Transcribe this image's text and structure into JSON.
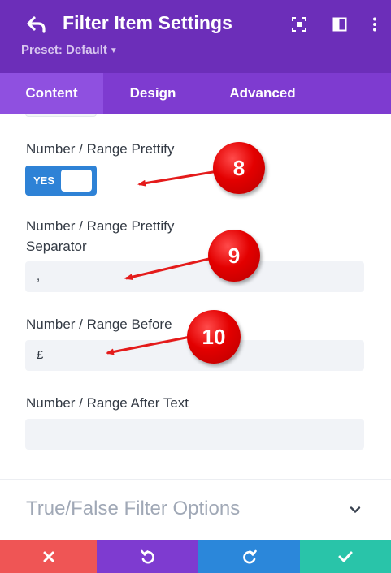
{
  "header": {
    "title": "Filter Item Settings",
    "preset_label": "Preset: Default",
    "icons": [
      "back-icon",
      "focus-icon",
      "sidebar-layout-icon",
      "more-icon"
    ],
    "bg_color": "#6c2eb9"
  },
  "tabs": [
    {
      "label": "Content",
      "active": true
    },
    {
      "label": "Design",
      "active": false
    },
    {
      "label": "Advanced",
      "active": false
    }
  ],
  "fields": {
    "prettify": {
      "label": "Number / Range Prettify",
      "toggle_text": "YES",
      "value": true
    },
    "separator": {
      "label_line1": "Number / Range Prettify",
      "label_line2": "Separator",
      "value": ","
    },
    "before_text": {
      "label": "Number / Range Before",
      "value": "£"
    },
    "after_text": {
      "label": "Number / Range After Text",
      "value": ""
    }
  },
  "section": {
    "title": "True/False Filter Options",
    "icon": "chevron-down-icon"
  },
  "callouts": [
    "8",
    "9",
    "10"
  ],
  "footer": {
    "buttons": [
      {
        "name": "discard",
        "icon": "close-icon",
        "color": "#ef5555"
      },
      {
        "name": "undo",
        "icon": "undo-icon",
        "color": "#7e3bd0"
      },
      {
        "name": "redo",
        "icon": "redo-icon",
        "color": "#2b87da"
      },
      {
        "name": "save",
        "icon": "check-icon",
        "color": "#29c4a9"
      }
    ]
  },
  "colors": {
    "accent": "#2e82d6",
    "callout": "#e30000",
    "arrow": "#e41b1b"
  }
}
